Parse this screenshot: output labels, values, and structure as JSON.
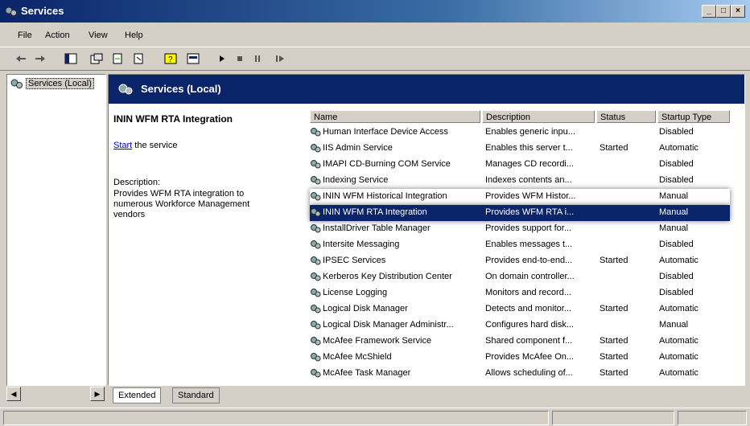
{
  "window": {
    "title": "Services"
  },
  "menu": [
    "File",
    "Action",
    "View",
    "Help"
  ],
  "toolbar_icons": [
    "back-arrow-icon",
    "forward-arrow-icon",
    "console-tree-icon",
    "properties-icon",
    "refresh-icon",
    "export-list-icon",
    "help-icon",
    "view-icon",
    "play-icon",
    "stop-icon",
    "pause-icon",
    "restart-icon"
  ],
  "tree": {
    "root_label": "Services (Local)"
  },
  "pane": {
    "header_title": "Services (Local)"
  },
  "details": {
    "service_name": "ININ WFM RTA Integration",
    "start_link": "Start",
    "start_suffix": " the service",
    "description_label": "Description:",
    "description_text": "Provides WFM RTA integration to numerous Workforce Management vendors"
  },
  "columns": [
    "Name",
    "Description",
    "Status",
    "Startup Type"
  ],
  "services": [
    {
      "name": "Human Interface Device Access",
      "description": "Enables generic inpu...",
      "status": "",
      "startup": "Disabled"
    },
    {
      "name": "IIS Admin Service",
      "description": "Enables this server t...",
      "status": "Started",
      "startup": "Automatic"
    },
    {
      "name": "IMAPI CD-Burning COM Service",
      "description": "Manages CD recordi...",
      "status": "",
      "startup": "Disabled"
    },
    {
      "name": "Indexing Service",
      "description": "Indexes contents an...",
      "status": "",
      "startup": "Disabled"
    },
    {
      "name": "ININ WFM Historical Integration",
      "description": "Provides WFM Histor...",
      "status": "",
      "startup": "Manual",
      "highlight": "white"
    },
    {
      "name": "ININ WFM RTA Integration",
      "description": "Provides WFM RTA i...",
      "status": "",
      "startup": "Manual",
      "highlight": "blue"
    },
    {
      "name": "InstallDriver Table Manager",
      "description": "Provides support for...",
      "status": "",
      "startup": "Manual"
    },
    {
      "name": "Intersite Messaging",
      "description": "Enables messages t...",
      "status": "",
      "startup": "Disabled"
    },
    {
      "name": "IPSEC Services",
      "description": "Provides end-to-end...",
      "status": "Started",
      "startup": "Automatic"
    },
    {
      "name": "Kerberos Key Distribution Center",
      "description": "On domain controller...",
      "status": "",
      "startup": "Disabled"
    },
    {
      "name": "License Logging",
      "description": "Monitors and record...",
      "status": "",
      "startup": "Disabled"
    },
    {
      "name": "Logical Disk Manager",
      "description": "Detects and monitor...",
      "status": "Started",
      "startup": "Automatic"
    },
    {
      "name": "Logical Disk Manager Administr...",
      "description": "Configures hard disk...",
      "status": "",
      "startup": "Manual"
    },
    {
      "name": "McAfee Framework Service",
      "description": "Shared component f...",
      "status": "Started",
      "startup": "Automatic"
    },
    {
      "name": "McAfee McShield",
      "description": "Provides McAfee On...",
      "status": "Started",
      "startup": "Automatic"
    },
    {
      "name": "McAfee Task Manager",
      "description": "Allows scheduling of...",
      "status": "Started",
      "startup": "Automatic"
    }
  ],
  "tabs": [
    "Extended",
    "Standard"
  ],
  "colors": {
    "title_bar": "#0a246a",
    "selection": "#0a246a",
    "chrome": "#d4d0c8"
  }
}
